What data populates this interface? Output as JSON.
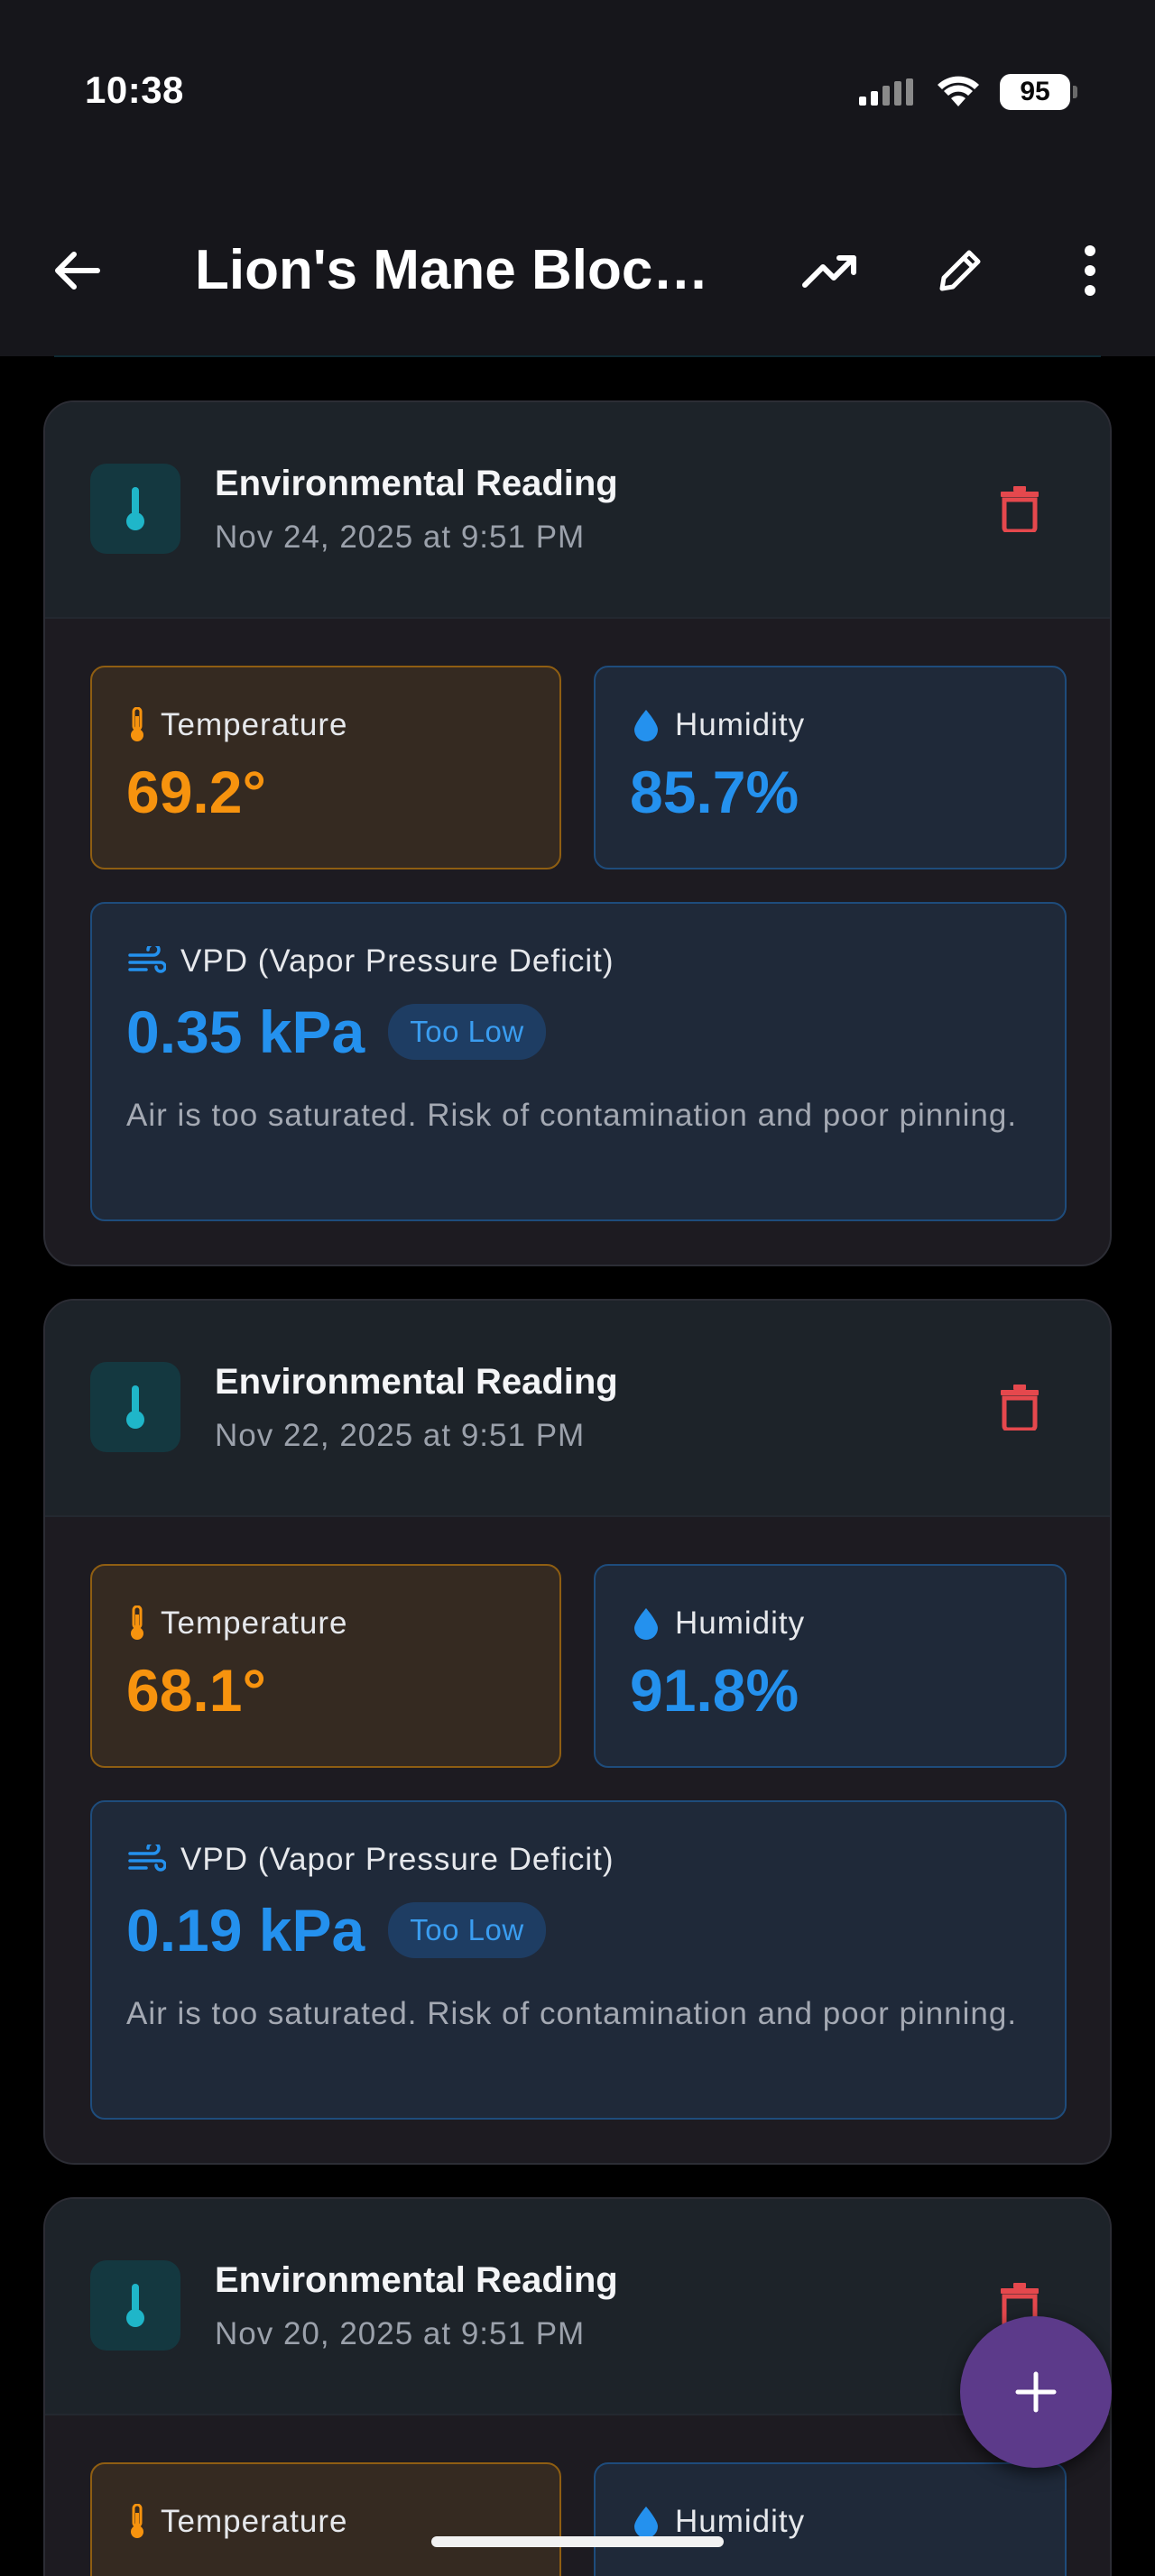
{
  "status_bar": {
    "time": "10:38",
    "battery": "95"
  },
  "app_bar": {
    "title": "Lion's Mane Block…"
  },
  "colors": {
    "temperature": "#f7930e",
    "humidity": "#2491ee",
    "delete": "#e5484d",
    "fab": "#5c3a8a",
    "accent_teal": "#1fb6c9"
  },
  "readings": [
    {
      "title": "Environmental Reading",
      "date": "Nov 24, 2025 at 9:51 PM",
      "temperature_label": "Temperature",
      "temperature": "69.2°",
      "humidity_label": "Humidity",
      "humidity": "85.7%",
      "vpd_label": "VPD (Vapor Pressure Deficit)",
      "vpd": "0.35 kPa",
      "vpd_status": "Too Low",
      "vpd_note": "Air is too saturated. Risk of contamination and poor pinning."
    },
    {
      "title": "Environmental Reading",
      "date": "Nov 22, 2025 at 9:51 PM",
      "temperature_label": "Temperature",
      "temperature": "68.1°",
      "humidity_label": "Humidity",
      "humidity": "91.8%",
      "vpd_label": "VPD (Vapor Pressure Deficit)",
      "vpd": "0.19 kPa",
      "vpd_status": "Too Low",
      "vpd_note": "Air is too saturated. Risk of contamination and poor pinning."
    },
    {
      "title": "Environmental Reading",
      "date": "Nov 20, 2025 at 9:51 PM",
      "temperature_label": "Temperature",
      "humidity_label": "Humidity"
    }
  ]
}
